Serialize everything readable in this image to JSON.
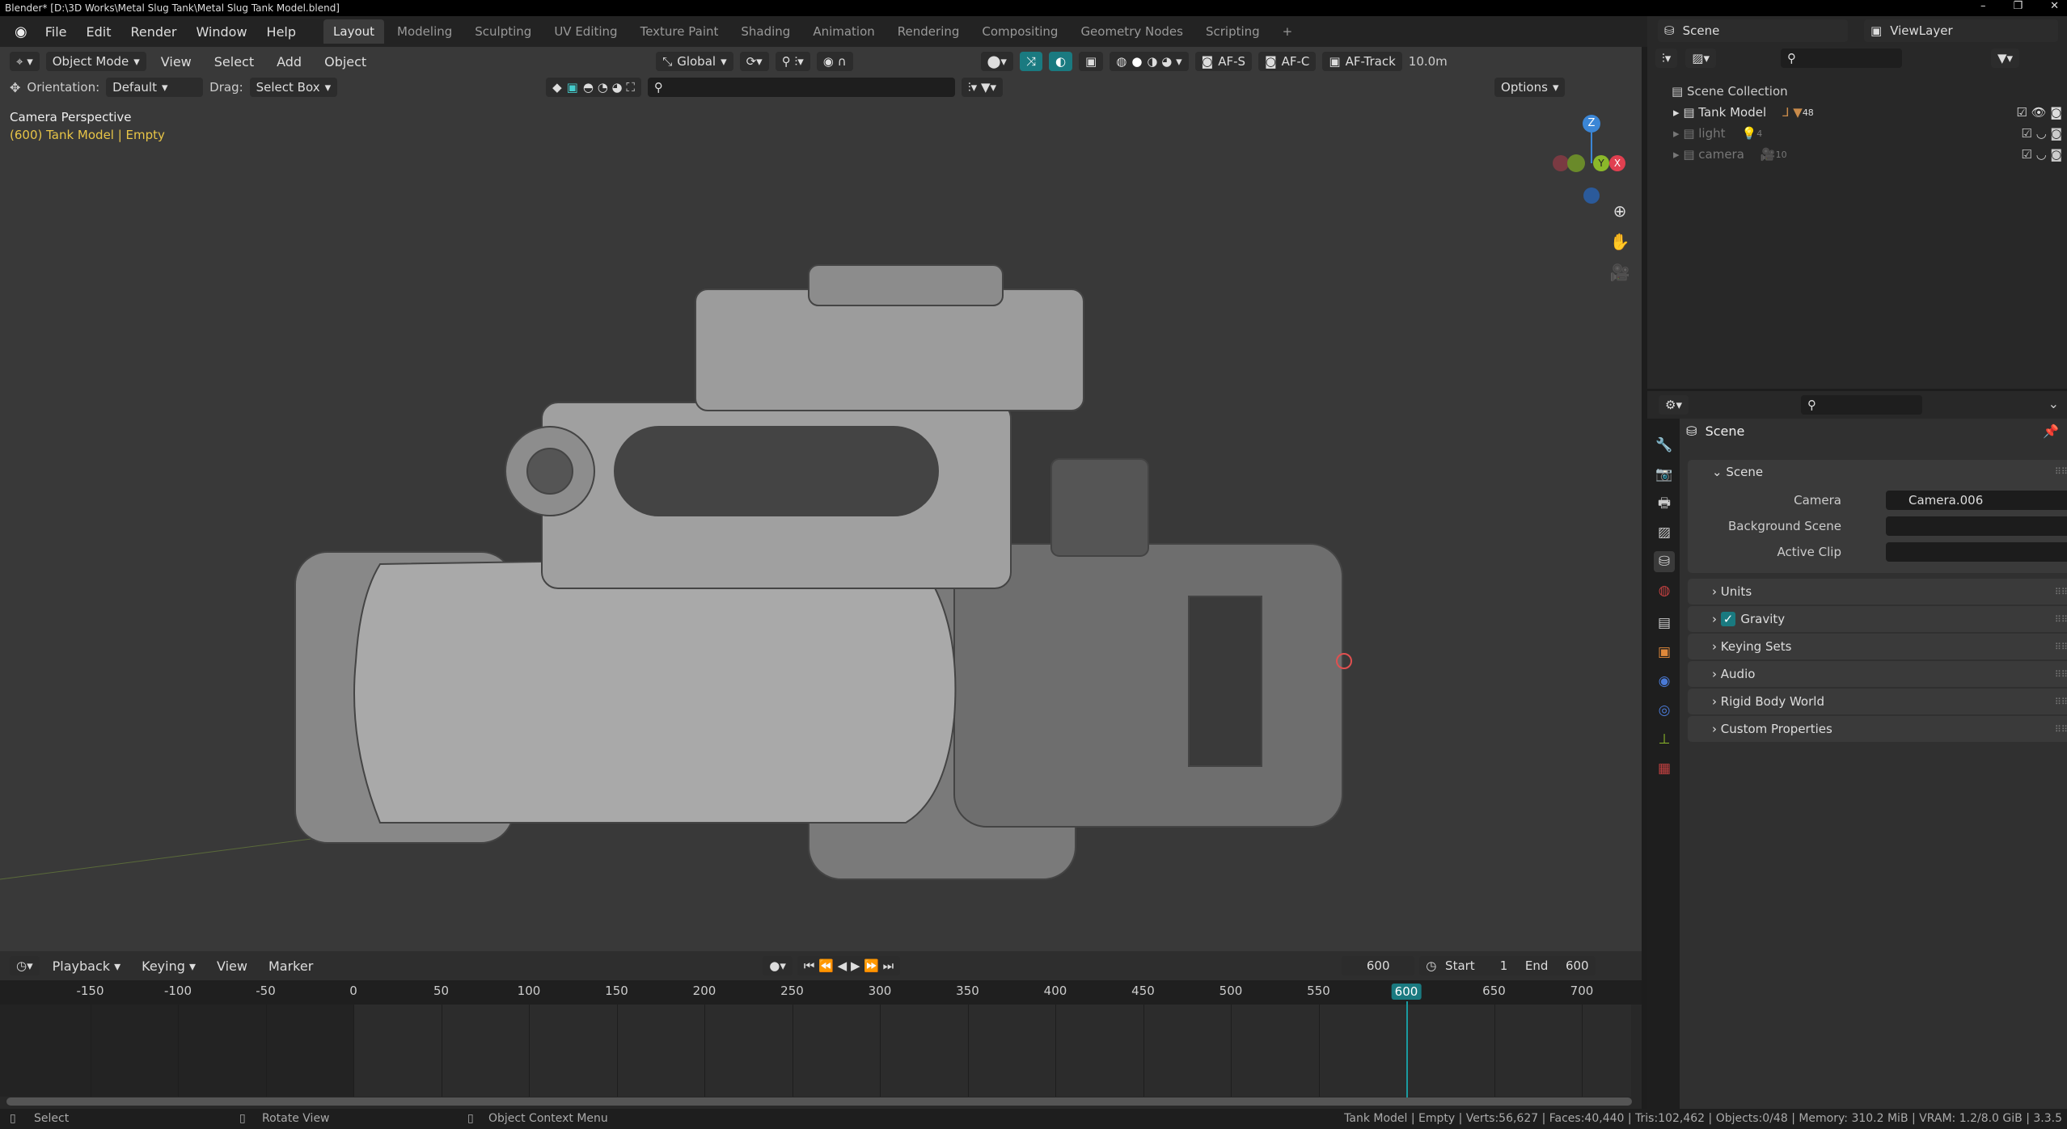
{
  "title_bar": {
    "text": "Blender* [D:\\3D Works\\Metal Slug Tank\\Metal Slug Tank Model.blend]",
    "minimize": "–",
    "maximize": "❐",
    "close": "✕"
  },
  "menu": {
    "items": [
      "File",
      "Edit",
      "Render",
      "Window",
      "Help"
    ],
    "workspaces": [
      "Layout",
      "Modeling",
      "Sculpting",
      "UV Editing",
      "Texture Paint",
      "Shading",
      "Animation",
      "Rendering",
      "Compositing",
      "Geometry Nodes",
      "Scripting"
    ],
    "add_workspace": "+",
    "active_workspace": "Layout"
  },
  "scene_selector": {
    "scene": "Scene",
    "view_layer": "ViewLayer"
  },
  "viewport": {
    "header": {
      "mode": "Object Mode",
      "menus": [
        "View",
        "Select",
        "Add",
        "Object"
      ],
      "transform_orientation": "Global",
      "af_s": "AF-S",
      "af_c": "AF-C",
      "af_track": "AF-Track",
      "distance": "10.0m"
    },
    "tool_settings": {
      "orientation_label": "Orientation:",
      "orientation": "Default",
      "drag_label": "Drag:",
      "drag": "Select Box",
      "options": "Options"
    },
    "overlay_text": {
      "view_name": "Camera Perspective",
      "object_info": "(600) Tank Model | Empty"
    },
    "gizmo": {
      "x": "X",
      "y": "Y",
      "z": "Z"
    }
  },
  "outliner": {
    "root": "Scene Collection",
    "items": [
      {
        "name": "Tank Model",
        "count": "48"
      },
      {
        "name": "light",
        "count": "4"
      },
      {
        "name": "camera",
        "count": "10"
      }
    ]
  },
  "properties": {
    "context": "Scene",
    "panels": {
      "scene": "Scene",
      "camera_label": "Camera",
      "camera_value": "Camera.006",
      "bg_scene_label": "Background Scene",
      "active_clip_label": "Active Clip"
    },
    "collapsed": [
      "Units",
      "Gravity",
      "Keying Sets",
      "Audio",
      "Rigid Body World",
      "Custom Properties"
    ]
  },
  "timeline": {
    "menus": [
      "Playback",
      "Keying",
      "View",
      "Marker"
    ],
    "current_frame": "600",
    "start_label": "Start",
    "start": "1",
    "end_label": "End",
    "end": "600",
    "ticks": [
      -150,
      -100,
      -50,
      0,
      50,
      100,
      150,
      200,
      250,
      300,
      350,
      400,
      450,
      500,
      550,
      600,
      650,
      700
    ],
    "playhead": 600
  },
  "status_bar": {
    "select": "Select",
    "rotate": "Rotate View",
    "context_menu": "Object Context Menu",
    "stats": "Tank Model | Empty | Verts:56,627 | Faces:40,440 | Tris:102,462 | Objects:0/48 | Memory: 310.2 MiB | VRAM: 1.2/8.0 GiB | 3.3.5"
  },
  "colors": {
    "accent": "#1a7a80",
    "object_info": "#e8c547",
    "x_axis": "#e04050",
    "y_axis": "#8bb82a",
    "z_axis": "#3b86d6"
  }
}
